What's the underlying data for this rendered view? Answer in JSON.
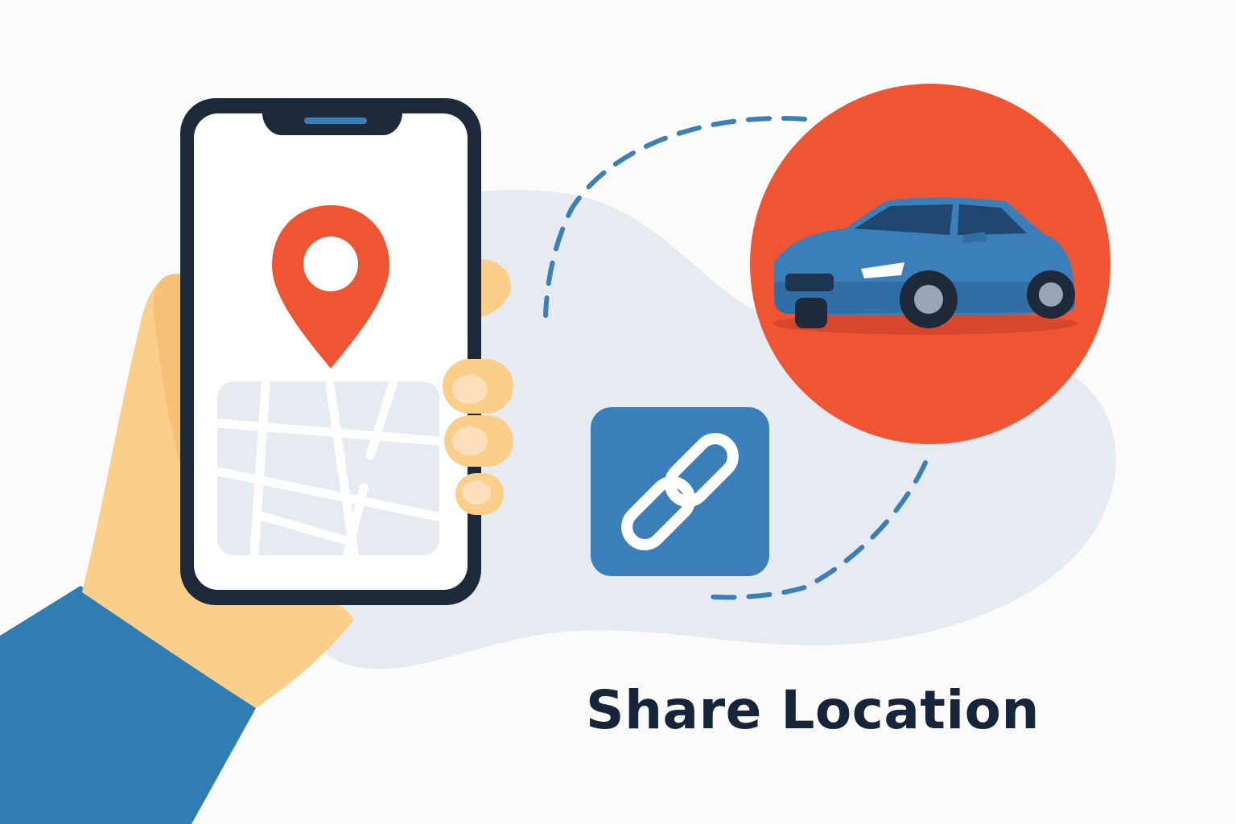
{
  "caption": {
    "text": "Share Location"
  },
  "icons": {
    "phone": "smartphone-icon",
    "pin": "location-pin-icon",
    "map": "map-icon",
    "link": "link-chain-icon",
    "car": "car-icon"
  },
  "colors": {
    "background": "#fbfbfb",
    "blob": "#e6ebf2",
    "navy": "#1e2a3a",
    "accent_red": "#ef5533",
    "accent_blue": "#3a7fba",
    "sleeve_blue": "#2f7db3",
    "skin": "#fbcf8a",
    "text": "#17253a"
  }
}
